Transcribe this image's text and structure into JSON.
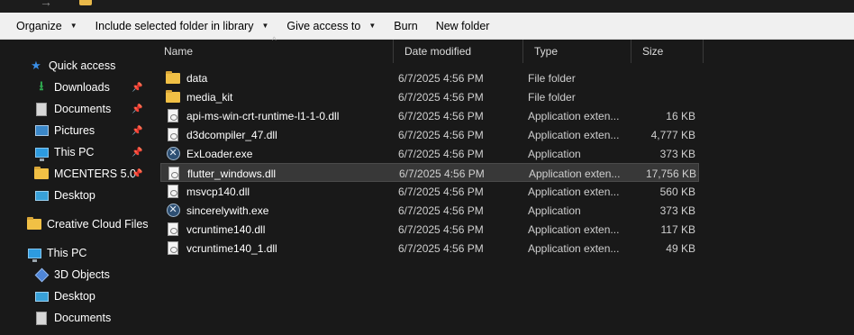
{
  "command_bar": {
    "organize": "Organize",
    "include_library": "Include selected folder in library",
    "give_access": "Give access to",
    "burn": "Burn",
    "new_folder": "New folder"
  },
  "nav": {
    "items": [
      {
        "label": "Quick access",
        "icon": "star-icon"
      },
      {
        "label": "Downloads",
        "icon": "download-icon",
        "pinned": true
      },
      {
        "label": "Documents",
        "icon": "document-icon",
        "pinned": true
      },
      {
        "label": "Pictures",
        "icon": "pictures-icon",
        "pinned": true
      },
      {
        "label": "This PC",
        "icon": "computer-icon",
        "pinned": true
      },
      {
        "label": "MCENTERS 5.0",
        "icon": "folder-icon",
        "pinned": true
      },
      {
        "label": "Desktop",
        "icon": "desktop-icon"
      },
      {
        "label": "Creative Cloud Files",
        "icon": "folder-icon"
      },
      {
        "label": "This PC",
        "icon": "computer-icon"
      },
      {
        "label": "3D Objects",
        "icon": "cube-icon"
      },
      {
        "label": "Desktop",
        "icon": "desktop-icon"
      },
      {
        "label": "Documents",
        "icon": "document-icon"
      }
    ]
  },
  "columns": {
    "name": "Name",
    "date": "Date modified",
    "type": "Type",
    "size": "Size"
  },
  "files": [
    {
      "name": "data",
      "date": "6/7/2025 4:56 PM",
      "type": "File folder",
      "size": "",
      "icon": "folder-icon"
    },
    {
      "name": "media_kit",
      "date": "6/7/2025 4:56 PM",
      "type": "File folder",
      "size": "",
      "icon": "folder-icon"
    },
    {
      "name": "api-ms-win-crt-runtime-l1-1-0.dll",
      "date": "6/7/2025 4:56 PM",
      "type": "Application exten...",
      "size": "16 KB",
      "icon": "dll-icon"
    },
    {
      "name": "d3dcompiler_47.dll",
      "date": "6/7/2025 4:56 PM",
      "type": "Application exten...",
      "size": "4,777 KB",
      "icon": "dll-icon"
    },
    {
      "name": "ExLoader.exe",
      "date": "6/7/2025 4:56 PM",
      "type": "Application",
      "size": "373 KB",
      "icon": "exe-icon"
    },
    {
      "name": "flutter_windows.dll",
      "date": "6/7/2025 4:56 PM",
      "type": "Application exten...",
      "size": "17,756 KB",
      "icon": "dll-icon",
      "selected": true
    },
    {
      "name": "msvcp140.dll",
      "date": "6/7/2025 4:56 PM",
      "type": "Application exten...",
      "size": "560 KB",
      "icon": "dll-icon"
    },
    {
      "name": "sincerelywith.exe",
      "date": "6/7/2025 4:56 PM",
      "type": "Application",
      "size": "373 KB",
      "icon": "exe-icon"
    },
    {
      "name": "vcruntime140.dll",
      "date": "6/7/2025 4:56 PM",
      "type": "Application exten...",
      "size": "117 KB",
      "icon": "dll-icon"
    },
    {
      "name": "vcruntime140_1.dll",
      "date": "6/7/2025 4:56 PM",
      "type": "Application exten...",
      "size": "49 KB",
      "icon": "dll-icon"
    }
  ]
}
